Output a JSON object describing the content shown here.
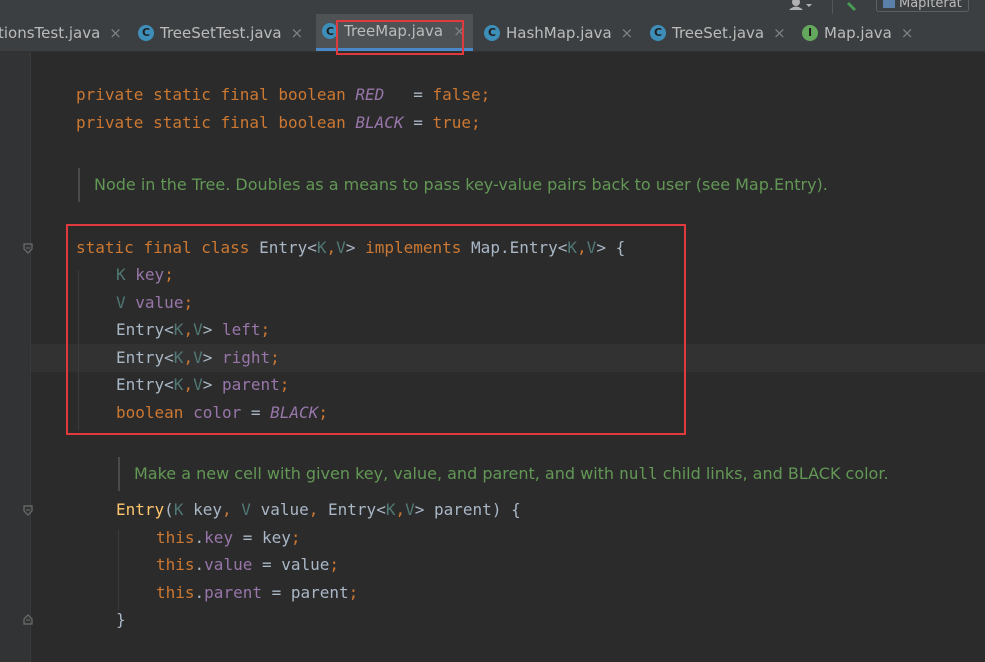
{
  "window": {
    "top_right_label": "MapIterat"
  },
  "tabs": [
    {
      "label": "tionsTest.java",
      "icon": "",
      "active": false
    },
    {
      "label": "TreeSetTest.java",
      "icon": "C",
      "active": false
    },
    {
      "label": "TreeMap.java",
      "icon": "C",
      "active": true
    },
    {
      "label": "HashMap.java",
      "icon": "C",
      "active": false
    },
    {
      "label": "TreeSet.java",
      "icon": "C",
      "active": false
    },
    {
      "label": "Map.java",
      "icon": "I",
      "active": false
    }
  ],
  "close_glyph": "×",
  "code": {
    "red_line": [
      "private",
      "static",
      "final",
      "boolean",
      "RED",
      "=",
      "false",
      ";"
    ],
    "black_line": [
      "private",
      "static",
      "final",
      "boolean",
      "BLACK",
      "=",
      "true",
      ";"
    ],
    "doc_node": "Node in the Tree. Doubles as a means to pass key-value pairs back to user (see Map.Entry).",
    "class_decl": {
      "kw1": "static",
      "kw2": "final",
      "kw3": "class",
      "name": "Entry",
      "lt": "<",
      "K": "K",
      "comma": ",",
      "V": "V",
      "gt": ">",
      "implements": "implements",
      "iface": "Map.Entry",
      "brace": "{"
    },
    "fields": [
      {
        "type": "K",
        "name": "key"
      },
      {
        "type": "V",
        "name": "value"
      },
      {
        "type": "Entry<K,V>",
        "name": "left"
      },
      {
        "type": "Entry<K,V>",
        "name": "right"
      },
      {
        "type": "Entry<K,V>",
        "name": "parent"
      },
      {
        "type": "boolean",
        "name": "color",
        "init": "BLACK"
      }
    ],
    "doc_ctor_pre": "Make a new cell with given key, value, and parent, and with",
    "doc_ctor_code": "null",
    "doc_ctor_post": "child links, and BLACK color.",
    "ctor": {
      "name": "Entry",
      "p1_type": "K",
      "p1": "key",
      "p2_type": "V",
      "p2": "value",
      "p3_type": "Entry",
      "p3": "parent",
      "open": "{"
    },
    "assigns": [
      {
        "this": "this",
        "field": "key",
        "value": "key"
      },
      {
        "this": "this",
        "field": "value",
        "value": "value"
      },
      {
        "this": "this",
        "field": "parent",
        "value": "parent"
      }
    ],
    "close_brace": "}"
  }
}
